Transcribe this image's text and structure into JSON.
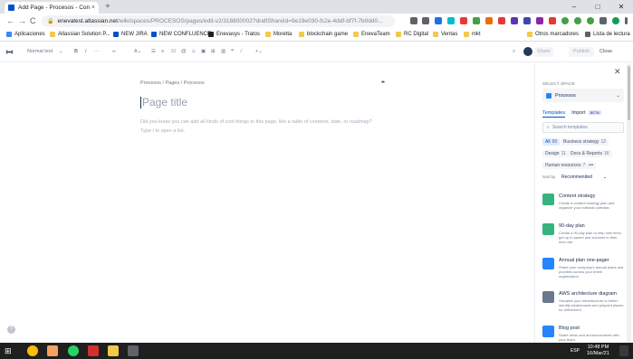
{
  "browser": {
    "tab_title": "Add Page - Procesos - Confluence",
    "tab_close": "×",
    "new_tab": "+",
    "window_controls": [
      "–",
      "□",
      "✕"
    ],
    "url_host": "enevatest.atlassian.net",
    "url_path": "/wiki/spaces/PROCESOS/pages/edit-v2/318800002?draftShareId=9e19e030-fc2e-4ddf-bf7f-7b0dd0...",
    "nav": [
      "←",
      "→",
      "C"
    ]
  },
  "bookmarks": [
    {
      "label": "Aplicaciones",
      "color": "#4285f4"
    },
    {
      "label": "Atlassian Solution P...",
      "color": "#f2c94c"
    },
    {
      "label": "NEW JIRA",
      "color": "#0052cc"
    },
    {
      "label": "NEW CONFLUENCE",
      "color": "#0052cc"
    },
    {
      "label": "Enevasys - Tratos",
      "color": "#202124"
    },
    {
      "label": "Moretta",
      "color": "#f2c94c"
    },
    {
      "label": "blockchain game",
      "color": "#f2c94c"
    },
    {
      "label": "EnevaTeam",
      "color": "#f2c94c"
    },
    {
      "label": "RC Digital",
      "color": "#f2c94c"
    },
    {
      "label": "Ventas",
      "color": "#f2c94c"
    },
    {
      "label": "mkt",
      "color": "#f2c94c"
    },
    {
      "label": "Otros marcadores",
      "color": "#f2c94c"
    },
    {
      "label": "Lista de lectura",
      "color": "#5f6368"
    }
  ],
  "editor_toolbar": {
    "text_style": "Normal text",
    "share": "Share",
    "publish": "Publish",
    "close": "Close"
  },
  "page": {
    "breadcrumb": "Procesos  /  Pages  /  Procesos",
    "title_placeholder": "Page title",
    "hint_line1": "Did you know you can add all kinds of cool things to this page, like a table of contents, date, or roadmap?",
    "hint_line2": "Type / to open a list.",
    "more": "••"
  },
  "sidebar": {
    "close": "✕",
    "select_space_label": "SELECT SPACE",
    "space": "Procesos",
    "tab_templates": "Templates",
    "tab_import": "Import",
    "beta": "BETA",
    "search_placeholder": "Search templates",
    "chips": [
      {
        "label": "All",
        "count": "88"
      },
      {
        "label": "Business strategy",
        "count": "12"
      },
      {
        "label": "Design",
        "count": "11"
      },
      {
        "label": "Docs & Reports",
        "count": "16"
      },
      {
        "label": "Human resources",
        "count": "7"
      },
      {
        "label": "•••",
        "count": ""
      }
    ],
    "sort_label": "Sort by",
    "sort_value": "Recommended",
    "templates": [
      {
        "name": "Content strategy",
        "desc": "Create a content strategy plan and organize your editorial calendar.",
        "color": "#36b37e"
      },
      {
        "name": "90-day plan",
        "desc": "Create a 90-day plan to help new hires get up to speed and succeed in their new role.",
        "color": "#36b37e"
      },
      {
        "name": "Annual plan one-pager",
        "desc": "Share your company's annual plans and priorities across your entire organization.",
        "color": "#2684ff"
      },
      {
        "name": "AWS architecture diagram",
        "desc": "Visualize your infrastructure to better identify weaknesses and pinpoint places for refinement.",
        "color": "#6b778c"
      },
      {
        "name": "Blog post",
        "desc": "Share news and announcements with your team.",
        "color": "#2684ff"
      }
    ]
  },
  "taskbar": {
    "lang": "ESP",
    "time": "10:48 PM",
    "date": "16/Mar/21"
  }
}
